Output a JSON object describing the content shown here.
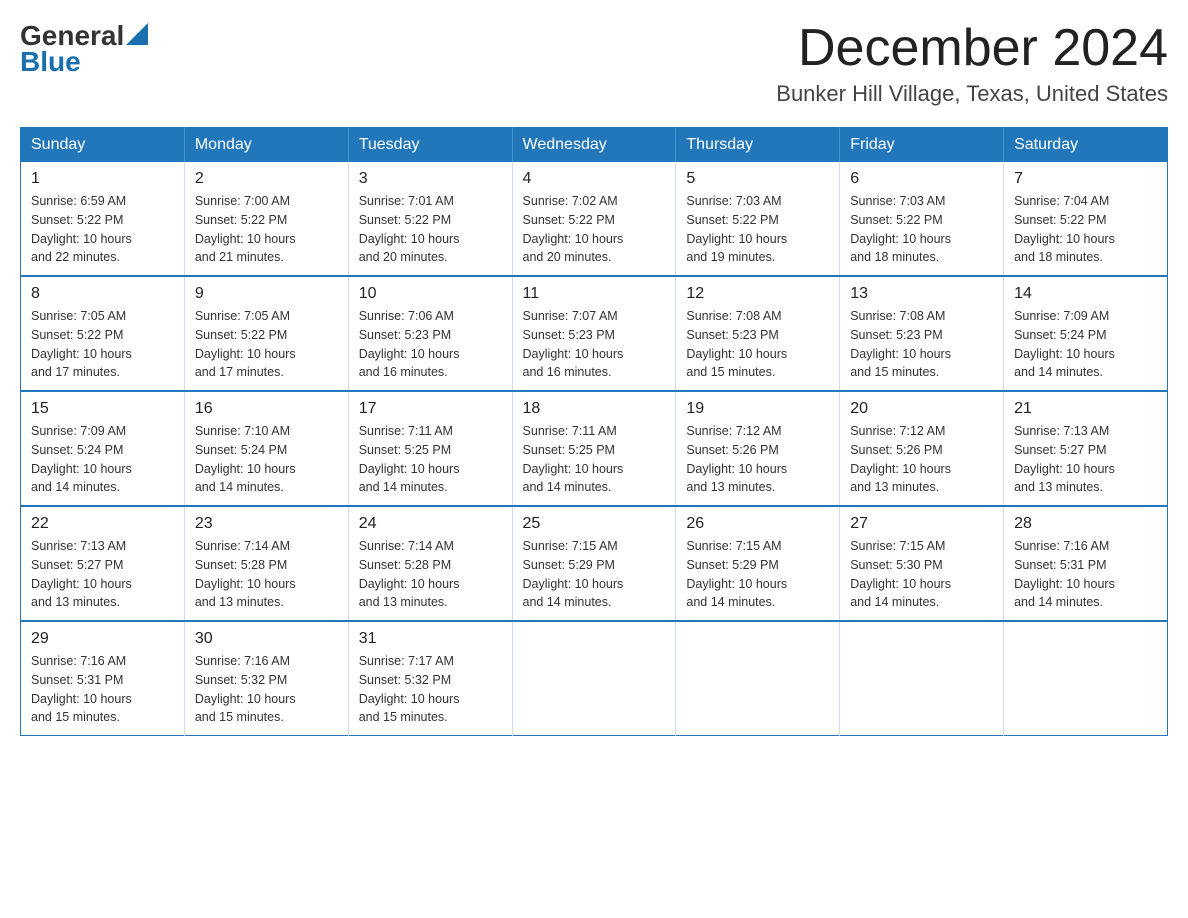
{
  "header": {
    "logo_general": "General",
    "logo_blue": "Blue",
    "title": "December 2024",
    "subtitle": "Bunker Hill Village, Texas, United States"
  },
  "weekdays": [
    "Sunday",
    "Monday",
    "Tuesday",
    "Wednesday",
    "Thursday",
    "Friday",
    "Saturday"
  ],
  "weeks": [
    [
      {
        "day": "1",
        "sunrise": "6:59 AM",
        "sunset": "5:22 PM",
        "daylight": "10 hours and 22 minutes."
      },
      {
        "day": "2",
        "sunrise": "7:00 AM",
        "sunset": "5:22 PM",
        "daylight": "10 hours and 21 minutes."
      },
      {
        "day": "3",
        "sunrise": "7:01 AM",
        "sunset": "5:22 PM",
        "daylight": "10 hours and 20 minutes."
      },
      {
        "day": "4",
        "sunrise": "7:02 AM",
        "sunset": "5:22 PM",
        "daylight": "10 hours and 20 minutes."
      },
      {
        "day": "5",
        "sunrise": "7:03 AM",
        "sunset": "5:22 PM",
        "daylight": "10 hours and 19 minutes."
      },
      {
        "day": "6",
        "sunrise": "7:03 AM",
        "sunset": "5:22 PM",
        "daylight": "10 hours and 18 minutes."
      },
      {
        "day": "7",
        "sunrise": "7:04 AM",
        "sunset": "5:22 PM",
        "daylight": "10 hours and 18 minutes."
      }
    ],
    [
      {
        "day": "8",
        "sunrise": "7:05 AM",
        "sunset": "5:22 PM",
        "daylight": "10 hours and 17 minutes."
      },
      {
        "day": "9",
        "sunrise": "7:05 AM",
        "sunset": "5:22 PM",
        "daylight": "10 hours and 17 minutes."
      },
      {
        "day": "10",
        "sunrise": "7:06 AM",
        "sunset": "5:23 PM",
        "daylight": "10 hours and 16 minutes."
      },
      {
        "day": "11",
        "sunrise": "7:07 AM",
        "sunset": "5:23 PM",
        "daylight": "10 hours and 16 minutes."
      },
      {
        "day": "12",
        "sunrise": "7:08 AM",
        "sunset": "5:23 PM",
        "daylight": "10 hours and 15 minutes."
      },
      {
        "day": "13",
        "sunrise": "7:08 AM",
        "sunset": "5:23 PM",
        "daylight": "10 hours and 15 minutes."
      },
      {
        "day": "14",
        "sunrise": "7:09 AM",
        "sunset": "5:24 PM",
        "daylight": "10 hours and 14 minutes."
      }
    ],
    [
      {
        "day": "15",
        "sunrise": "7:09 AM",
        "sunset": "5:24 PM",
        "daylight": "10 hours and 14 minutes."
      },
      {
        "day": "16",
        "sunrise": "7:10 AM",
        "sunset": "5:24 PM",
        "daylight": "10 hours and 14 minutes."
      },
      {
        "day": "17",
        "sunrise": "7:11 AM",
        "sunset": "5:25 PM",
        "daylight": "10 hours and 14 minutes."
      },
      {
        "day": "18",
        "sunrise": "7:11 AM",
        "sunset": "5:25 PM",
        "daylight": "10 hours and 14 minutes."
      },
      {
        "day": "19",
        "sunrise": "7:12 AM",
        "sunset": "5:26 PM",
        "daylight": "10 hours and 13 minutes."
      },
      {
        "day": "20",
        "sunrise": "7:12 AM",
        "sunset": "5:26 PM",
        "daylight": "10 hours and 13 minutes."
      },
      {
        "day": "21",
        "sunrise": "7:13 AM",
        "sunset": "5:27 PM",
        "daylight": "10 hours and 13 minutes."
      }
    ],
    [
      {
        "day": "22",
        "sunrise": "7:13 AM",
        "sunset": "5:27 PM",
        "daylight": "10 hours and 13 minutes."
      },
      {
        "day": "23",
        "sunrise": "7:14 AM",
        "sunset": "5:28 PM",
        "daylight": "10 hours and 13 minutes."
      },
      {
        "day": "24",
        "sunrise": "7:14 AM",
        "sunset": "5:28 PM",
        "daylight": "10 hours and 13 minutes."
      },
      {
        "day": "25",
        "sunrise": "7:15 AM",
        "sunset": "5:29 PM",
        "daylight": "10 hours and 14 minutes."
      },
      {
        "day": "26",
        "sunrise": "7:15 AM",
        "sunset": "5:29 PM",
        "daylight": "10 hours and 14 minutes."
      },
      {
        "day": "27",
        "sunrise": "7:15 AM",
        "sunset": "5:30 PM",
        "daylight": "10 hours and 14 minutes."
      },
      {
        "day": "28",
        "sunrise": "7:16 AM",
        "sunset": "5:31 PM",
        "daylight": "10 hours and 14 minutes."
      }
    ],
    [
      {
        "day": "29",
        "sunrise": "7:16 AM",
        "sunset": "5:31 PM",
        "daylight": "10 hours and 15 minutes."
      },
      {
        "day": "30",
        "sunrise": "7:16 AM",
        "sunset": "5:32 PM",
        "daylight": "10 hours and 15 minutes."
      },
      {
        "day": "31",
        "sunrise": "7:17 AM",
        "sunset": "5:32 PM",
        "daylight": "10 hours and 15 minutes."
      },
      null,
      null,
      null,
      null
    ]
  ],
  "labels": {
    "sunrise": "Sunrise:",
    "sunset": "Sunset:",
    "daylight": "Daylight:"
  }
}
